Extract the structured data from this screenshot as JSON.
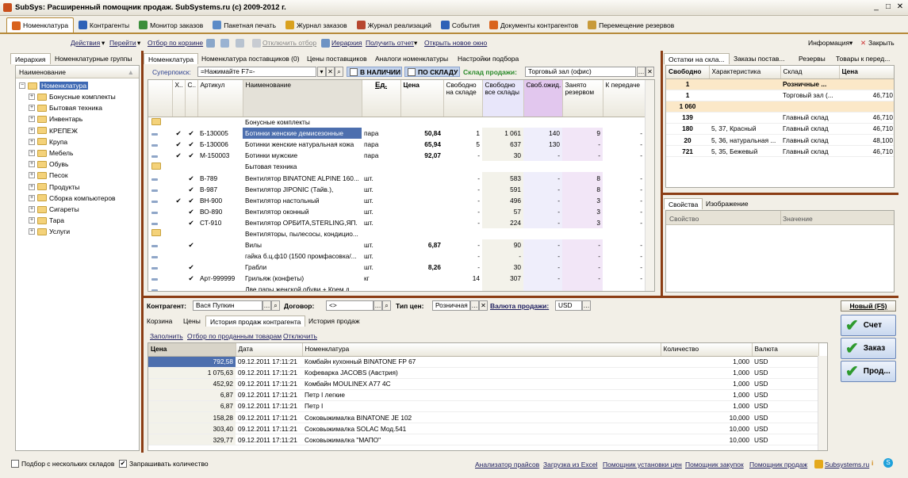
{
  "window": {
    "title": "SubSys: Расширенный помощник продаж. SubSystems.ru (c) 2009-2012 г."
  },
  "main_tabs": [
    {
      "label": "Номенклатура",
      "color": "#d9631e"
    },
    {
      "label": "Контрагенты",
      "color": "#2f62b7"
    },
    {
      "label": "Монитор заказов",
      "color": "#3b8f3b"
    },
    {
      "label": "Пакетная печать",
      "color": "#5b8bc7"
    },
    {
      "label": "Журнал заказов",
      "color": "#d9a11e"
    },
    {
      "label": "Журнал реализаций",
      "color": "#b7472f"
    },
    {
      "label": "События",
      "color": "#2f62b7"
    },
    {
      "label": "Документы контрагентов",
      "color": "#d9631e"
    },
    {
      "label": "Перемещение резервов",
      "color": "#c89a3a"
    }
  ],
  "toolbar": {
    "actions": "Действия",
    "goto": "Перейти",
    "by_cart": "Отбор по корзине",
    "disable_filter": "Отключить отбор",
    "hierarchy": "Иерархия",
    "get_report": "Получить отчет",
    "open_new_window": "Открыть новое окно",
    "info": "Информация",
    "close": "Закрыть"
  },
  "left_panel": {
    "tabs": [
      "Иерархия",
      "Номенклатурные группы"
    ],
    "column": "Наименование",
    "root": "Номенклатура",
    "items": [
      "Бонусные комплекты",
      "Бытовая техника",
      "Инвентарь",
      "КРЕПЕЖ",
      "Крупа",
      "Мебель",
      "Обувь",
      "Песок",
      "Продукты",
      "Сборка компьютеров",
      "Сигареты",
      "Тара",
      "Услуги"
    ]
  },
  "center": {
    "tabs": [
      "Номенклатура",
      "Номенклатура поставщиков (0)",
      "Цены поставщиков",
      "Аналоги номенклатуры",
      "Настройки подбора"
    ],
    "search_label": "Суперпоиск:",
    "search_value": "=Нажимайте F7=-",
    "in_stock": "В НАЛИЧИИ",
    "by_warehouse": "ПО СКЛАДУ",
    "sale_wh_label": "Склад продажи:",
    "sale_wh_value": "Торговый зал (офис)",
    "columns": [
      "Х..",
      "С..",
      "Артикул",
      "Наименование",
      "Ед.",
      "Цена",
      "Свободно на складе",
      "Свободно все склады",
      "Своб.ожид.",
      "Занято резервом",
      "К передаче"
    ],
    "rows": [
      {
        "type": "folder",
        "x": "",
        "c": "",
        "art": "",
        "name": "Бонусные комплекты",
        "unit": "",
        "price": "",
        "free": "",
        "all": "",
        "exp": "",
        "res": "",
        "tr": ""
      },
      {
        "type": "item",
        "x": "✔",
        "c": "✔",
        "art": "Б-130005",
        "name": "Ботинки женские демисезонные",
        "unit": "пара",
        "price": "50,84",
        "free": "1",
        "all": "1 061",
        "exp": "140",
        "res": "9",
        "tr": "-"
      },
      {
        "type": "item",
        "x": "✔",
        "c": "✔",
        "art": "Б-130006",
        "name": "Ботинки женские натуральная кожа",
        "unit": "пара",
        "price": "65,94",
        "free": "5",
        "all": "637",
        "exp": "130",
        "res": "-",
        "tr": "-"
      },
      {
        "type": "item",
        "x": "✔",
        "c": "✔",
        "art": "М-150003",
        "name": "Ботинки мужские",
        "unit": "пара",
        "price": "92,07",
        "free": "-",
        "all": "30",
        "exp": "-",
        "res": "-",
        "tr": "-"
      },
      {
        "type": "folder",
        "x": "",
        "c": "",
        "art": "",
        "name": "Бытовая техника",
        "unit": "",
        "price": "",
        "free": "",
        "all": "",
        "exp": "",
        "res": "",
        "tr": ""
      },
      {
        "type": "item",
        "x": "",
        "c": "✔",
        "art": "В-789",
        "name": "Вентилятор BINATONE ALPINE 160...",
        "unit": "шт.",
        "price": "",
        "free": "-",
        "all": "583",
        "exp": "-",
        "res": "8",
        "tr": "-"
      },
      {
        "type": "item",
        "x": "",
        "c": "✔",
        "art": "В-987",
        "name": "Вентилятор JIPONIC (Тайв.),",
        "unit": "шт.",
        "price": "",
        "free": "-",
        "all": "591",
        "exp": "-",
        "res": "8",
        "tr": "-"
      },
      {
        "type": "item",
        "x": "✔",
        "c": "✔",
        "art": "ВН-900",
        "name": "Вентилятор настольный",
        "unit": "шт.",
        "price": "",
        "free": "-",
        "all": "496",
        "exp": "-",
        "res": "3",
        "tr": "-"
      },
      {
        "type": "item",
        "x": "",
        "c": "✔",
        "art": "ВО-890",
        "name": "Вентилятор оконный",
        "unit": "шт.",
        "price": "",
        "free": "-",
        "all": "57",
        "exp": "-",
        "res": "3",
        "tr": "-"
      },
      {
        "type": "item",
        "x": "",
        "c": "✔",
        "art": "СТ-910",
        "name": "Вентилятор ОРБИТА,STERLING,ЯП.",
        "unit": "шт.",
        "price": "",
        "free": "-",
        "all": "224",
        "exp": "-",
        "res": "3",
        "tr": "-"
      },
      {
        "type": "folder",
        "x": "",
        "c": "",
        "art": "",
        "name": "Вентиляторы, пылесосы, кондицио...",
        "unit": "",
        "price": "",
        "free": "",
        "all": "",
        "exp": "",
        "res": "",
        "tr": ""
      },
      {
        "type": "item",
        "x": "",
        "c": "✔",
        "art": "",
        "name": "Вилы",
        "unit": "шт.",
        "price": "6,87",
        "free": "-",
        "all": "90",
        "exp": "-",
        "res": "-",
        "tr": "-"
      },
      {
        "type": "item",
        "x": "",
        "c": "",
        "art": "",
        "name": "гайка б.ц.ф10 (1500 промфасовка/...",
        "unit": "шт.",
        "price": "",
        "free": "-",
        "all": "-",
        "exp": "-",
        "res": "-",
        "tr": "-"
      },
      {
        "type": "item",
        "x": "",
        "c": "✔",
        "art": "",
        "name": "Грабли",
        "unit": "шт.",
        "price": "8,26",
        "free": "-",
        "all": "30",
        "exp": "-",
        "res": "-",
        "tr": "-"
      },
      {
        "type": "item",
        "x": "",
        "c": "✔",
        "art": "Арт-999999",
        "name": "Грильяж (конфеты)",
        "unit": "кг",
        "price": "",
        "free": "14",
        "all": "307",
        "exp": "-",
        "res": "-",
        "tr": "-"
      },
      {
        "type": "item",
        "x": "",
        "c": "",
        "art": "",
        "name": "Две пары женской обуви + Крем д...",
        "unit": "",
        "price": "",
        "free": "",
        "all": "",
        "exp": "",
        "res": "",
        "tr": ""
      }
    ]
  },
  "right_top": {
    "tabs": [
      "Остатки на скла...",
      "Заказы постав...",
      "Резервы",
      "Товары к перед..."
    ],
    "columns": [
      "Свободно",
      "Характеристика",
      "Склад",
      "Цена"
    ],
    "rows": [
      {
        "free": "1",
        "char": "",
        "wh": "Розничные ...",
        "price": "",
        "hl": true,
        "bold": true
      },
      {
        "free": "1",
        "char": "",
        "wh": "Торговый зал (...",
        "price": "46,710",
        "hl": false,
        "bold": false
      },
      {
        "free": "1 060",
        "char": "",
        "wh": "",
        "price": "",
        "hl": true,
        "bold": true
      },
      {
        "free": "139",
        "char": "",
        "wh": "Главный склад",
        "price": "46,710",
        "hl": false,
        "bold": false
      },
      {
        "free": "180",
        "char": "5, 37, Красный",
        "wh": "Главный склад",
        "price": "46,710",
        "hl": false,
        "bold": false
      },
      {
        "free": "20",
        "char": "5, 36, натуральная ...",
        "wh": "Главный склад",
        "price": "48,100",
        "hl": false,
        "bold": false
      },
      {
        "free": "721",
        "char": "5, 35, Бежевый",
        "wh": "Главный склад",
        "price": "46,710",
        "hl": false,
        "bold": false
      }
    ]
  },
  "right_mid": {
    "tabs": [
      "Свойства",
      "Изображение"
    ],
    "columns": [
      "Свойство",
      "Значение"
    ]
  },
  "bottom": {
    "contractor_label": "Контрагент:",
    "contractor_value": "Вася Пупкин",
    "contract_label": "Договор:",
    "contract_value": "<>",
    "price_type_label": "Тип цен:",
    "price_type_value": "Розничная",
    "currency_label": "Валюта продажи:",
    "currency_value": "USD",
    "tabs": [
      "Корзина",
      "Цены",
      "История продаж контрагента",
      "История продаж"
    ],
    "links": [
      "Заполнить",
      "Отбор по проданным товарам",
      "Отключить"
    ],
    "columns": [
      "Цена",
      "Дата",
      "Номенклатура",
      "Количество",
      "Валюта"
    ],
    "rows": [
      {
        "price": "792,58",
        "date": "09.12.2011 17:11:21",
        "name": "Комбайн кухонный BINATONE FP 67",
        "qty": "1,000",
        "cur": "USD"
      },
      {
        "price": "1 075,63",
        "date": "09.12.2011 17:11:21",
        "name": "Кофеварка JACOBS (Австрия)",
        "qty": "1,000",
        "cur": "USD"
      },
      {
        "price": "452,92",
        "date": "09.12.2011 17:11:21",
        "name": "Комбайн MOULINEX A77 4C",
        "qty": "1,000",
        "cur": "USD"
      },
      {
        "price": "6,87",
        "date": "09.12.2011 17:11:21",
        "name": "Петр I легкие",
        "qty": "1,000",
        "cur": "USD"
      },
      {
        "price": "6,87",
        "date": "09.12.2011 17:11:21",
        "name": "Петр I",
        "qty": "1,000",
        "cur": "USD"
      },
      {
        "price": "158,28",
        "date": "09.12.2011 17:11:21",
        "name": "Соковыжималка  BINATONE JE 102",
        "qty": "10,000",
        "cur": "USD"
      },
      {
        "price": "303,40",
        "date": "09.12.2011 17:11:21",
        "name": "Соковыжималка  SOLAC  Мод.541",
        "qty": "10,000",
        "cur": "USD"
      },
      {
        "price": "329,77",
        "date": "09.12.2011 17:11:21",
        "name": "Соковыжималка \"МАПО\"",
        "qty": "10,000",
        "cur": "USD"
      }
    ]
  },
  "actions": {
    "new": "Новый (F5)",
    "invoice": "Счет",
    "order": "Заказ",
    "sale": "Прод..."
  },
  "status": {
    "multi_wh": "Подбор с нескольких складов",
    "ask_qty": "Запрашивать количество",
    "links": [
      "Анализатор прайсов",
      "Загрузка из Excel",
      "Помощник установки цен",
      "Помощник закупок",
      "Помощник продаж"
    ],
    "site": "Subsystems.ru"
  }
}
